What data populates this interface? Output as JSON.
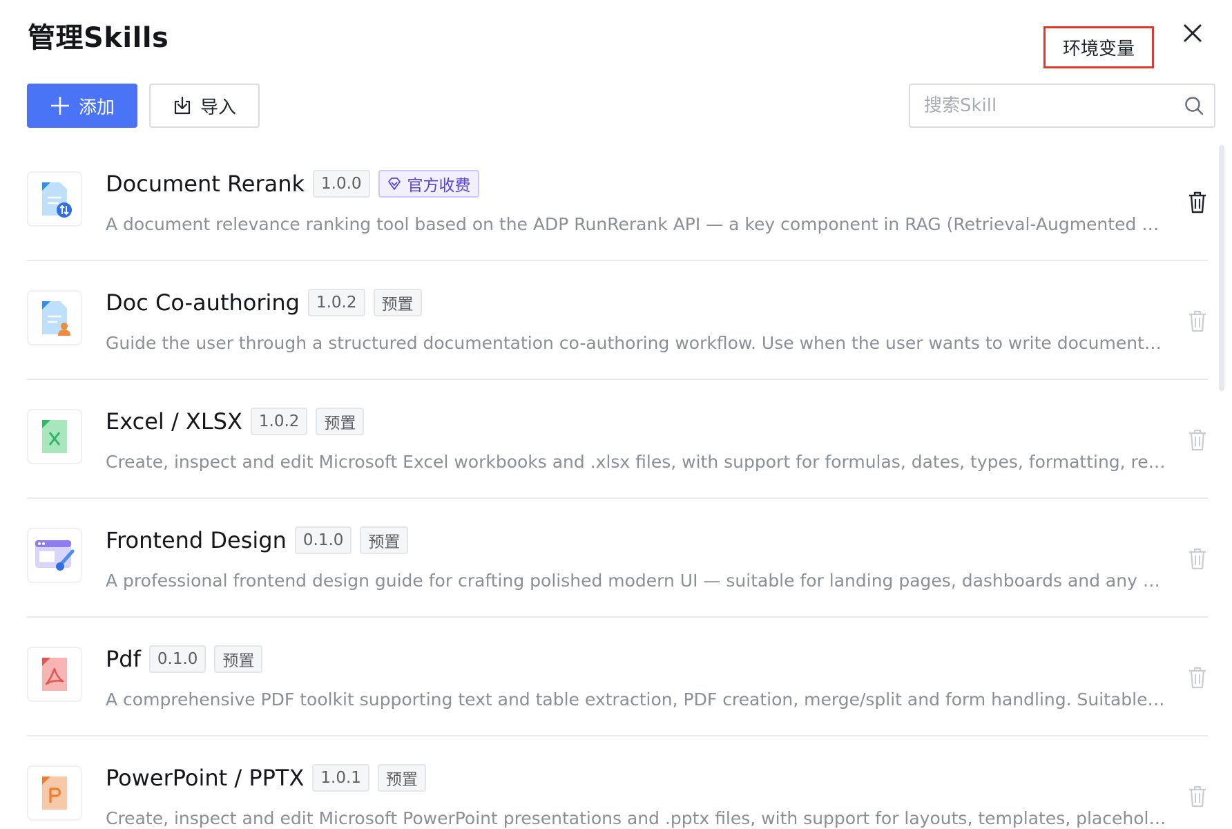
{
  "header": {
    "title": "管理Skills",
    "env_button": "环境变量"
  },
  "toolbar": {
    "add_label": "添加",
    "import_label": "导入"
  },
  "search": {
    "placeholder": "搜索Skill",
    "value": ""
  },
  "skills": [
    {
      "name": "Document Rerank",
      "version": "1.0.0",
      "tag": "官方收费",
      "tag_type": "official",
      "description": "A document relevance ranking tool based on the ADP RunRerank API — a key component in RAG (Retrieval-Augmented Generation) pipelines",
      "icon": "document-rerank-icon",
      "deletable": true
    },
    {
      "name": "Doc Co-authoring",
      "version": "1.0.2",
      "tag": "预置",
      "tag_type": "preset",
      "description": "Guide the user through a structured documentation co-authoring workflow. Use when the user wants to write documentation",
      "icon": "doc-coauthoring-icon",
      "deletable": false
    },
    {
      "name": "Excel / XLSX",
      "version": "1.0.2",
      "tag": "预置",
      "tag_type": "preset",
      "description": "Create, inspect and edit Microsoft Excel workbooks and .xlsx files, with support for formulas, dates, types, formatting, recalculation",
      "icon": "excel-icon",
      "deletable": false
    },
    {
      "name": "Frontend Design",
      "version": "0.1.0",
      "tag": "预置",
      "tag_type": "preset",
      "description": "A professional frontend design guide for crafting polished modern UI — suitable for landing pages, dashboards and any user interface",
      "icon": "frontend-design-icon",
      "deletable": false
    },
    {
      "name": "Pdf",
      "version": "0.1.0",
      "tag": "预置",
      "tag_type": "preset",
      "description": "A comprehensive PDF toolkit supporting text and table extraction, PDF creation, merge/split and form handling. Suitable for many document tasks",
      "icon": "pdf-icon",
      "deletable": false
    },
    {
      "name": "PowerPoint / PPTX",
      "version": "1.0.1",
      "tag": "预置",
      "tag_type": "preset",
      "description": "Create, inspect and edit Microsoft PowerPoint presentations and .pptx files, with support for layouts, templates, placeholders",
      "icon": "powerpoint-icon",
      "deletable": false
    }
  ],
  "colors": {
    "primary": "#4a74f5",
    "highlight_border": "#e0382b",
    "official_tag": "#5b43d6",
    "text_muted": "#8a8f97"
  }
}
